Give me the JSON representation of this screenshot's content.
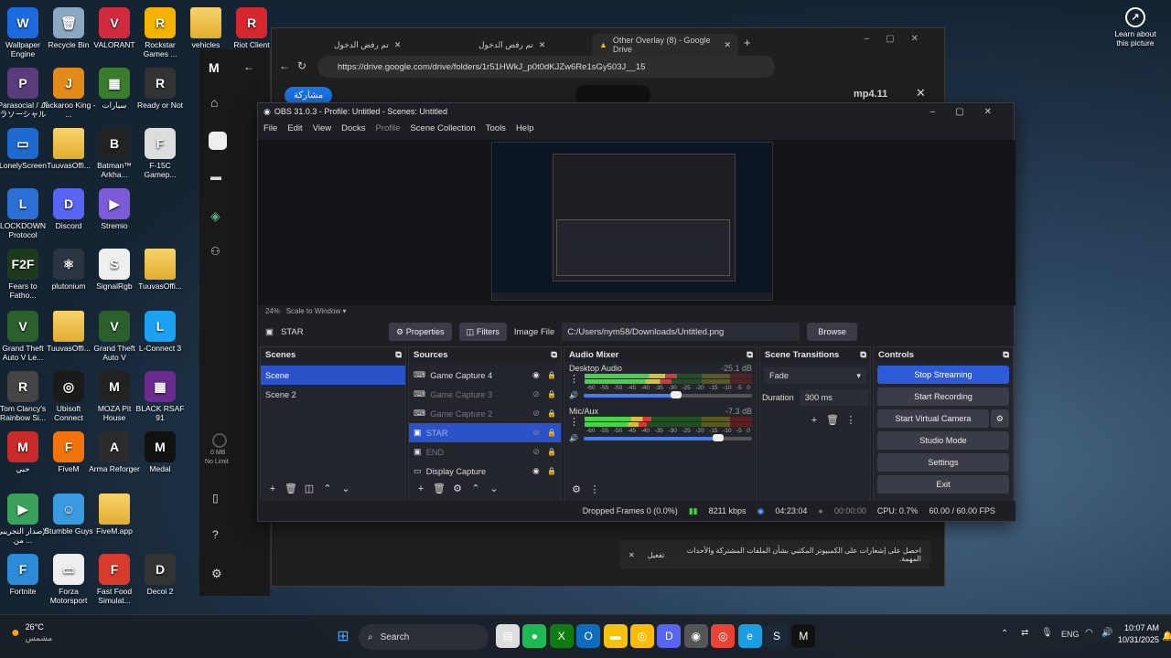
{
  "desktop_icons": [
    {
      "label": "Wallpaper Engine",
      "color": "#1c6be0",
      "glyph": "W"
    },
    {
      "label": "Recycle Bin",
      "color": "#8aa8c2",
      "glyph": "🗑"
    },
    {
      "label": "VALORANT",
      "color": "#d12a3c",
      "glyph": "V"
    },
    {
      "label": "Rockstar Games ...",
      "color": "#f5b300",
      "glyph": "R"
    },
    {
      "label": "vehicles",
      "color": "folder",
      "glyph": ""
    },
    {
      "label": "Riot Client",
      "color": "#d6262e",
      "glyph": "R"
    },
    {
      "label": "Parasocial / パラソーシャル",
      "color": "#5a3b7c",
      "glyph": "P"
    },
    {
      "label": "Jackaroo King - ...",
      "color": "#e28a1a",
      "glyph": "J"
    },
    {
      "label": "سيارات",
      "color": "#3a7c2e",
      "glyph": "▦"
    },
    {
      "label": "Ready or Not",
      "color": "#333",
      "glyph": "R"
    },
    {
      "label": "LonelyScreen",
      "color": "#1f6ad0",
      "glyph": "▭"
    },
    {
      "label": "TuuvasOffi...",
      "color": "folder",
      "glyph": ""
    },
    {
      "label": "Batman™ Arkha...",
      "color": "#222",
      "glyph": "B"
    },
    {
      "label": "F-15C Gamep...",
      "color": "#ddd",
      "glyph": "F"
    },
    {
      "label": "LOCKDOWN Protocol",
      "color": "#2c6fd4",
      "glyph": "L"
    },
    {
      "label": "Discord",
      "color": "#5865f2",
      "glyph": "D"
    },
    {
      "label": "Stremio",
      "color": "#7b5bd6",
      "glyph": "▶"
    },
    {
      "label": "Fears to Fatho...",
      "color": "#1d3a1d",
      "glyph": "F2F"
    },
    {
      "label": "plutonium",
      "color": "#2b3542",
      "glyph": "⚛"
    },
    {
      "label": "SignalRgb",
      "color": "#eee",
      "glyph": "S"
    },
    {
      "label": "TuuvasOffi...",
      "color": "folder",
      "glyph": ""
    },
    {
      "label": "Grand Theft Auto V Le...",
      "color": "#2b5f2b",
      "glyph": "V"
    },
    {
      "label": "TuuvasOffi...",
      "color": "folder",
      "glyph": ""
    },
    {
      "label": "Grand Theft Auto V",
      "color": "#2b5f2b",
      "glyph": "V"
    },
    {
      "label": "L-Connect 3",
      "color": "#1da1f2",
      "glyph": "L"
    },
    {
      "label": "Tom Clancy's Rainbow Si...",
      "color": "#444",
      "glyph": "R"
    },
    {
      "label": "Ubisoft Connect",
      "color": "#1b1b1b",
      "glyph": "◎"
    },
    {
      "label": "MOZA Pit House",
      "color": "#222",
      "glyph": "M"
    },
    {
      "label": "BLACK RSAF 91",
      "color": "#6a2b8f",
      "glyph": "▦"
    },
    {
      "label": "حبي",
      "color": "#c92a2a",
      "glyph": "M"
    },
    {
      "label": "FiveM",
      "color": "#f2720c",
      "glyph": "F"
    },
    {
      "label": "Arma Reforger",
      "color": "#2c2c2c",
      "glyph": "A"
    },
    {
      "label": "Medal",
      "color": "#111",
      "glyph": "M"
    },
    {
      "label": "الإصدار التجريبي من ...",
      "color": "#3aa15a",
      "glyph": "▶"
    },
    {
      "label": "Stumble Guys",
      "color": "#3b9be0",
      "glyph": "☺"
    },
    {
      "label": "FiveM.app",
      "color": "folder",
      "glyph": ""
    },
    {
      "label": "Fortnite",
      "color": "#2c8ad6",
      "glyph": "F"
    },
    {
      "label": "Forza Motorsport",
      "color": "#eee",
      "glyph": "▭"
    },
    {
      "label": "Fast Food Simulat...",
      "color": "#d83a2c",
      "glyph": "F"
    },
    {
      "label": "Decoi 2",
      "color": "#333",
      "glyph": "D"
    }
  ],
  "learn_about": "Learn about this picture",
  "browser": {
    "tabs": [
      "تم رفض الدخول",
      "تم رفض الدخول",
      "Other Overlay (8) - Google Drive"
    ],
    "url": "https://drive.google.com/drive/folders/1r51HWkJ_p0t0dKJZw6Re1sGy503J__15",
    "share_label": "مشاركة",
    "file_name": "mp4.11",
    "notification": "احصل على إشعارات على الكمبيوتر المكتبي بشأن الملفات المشتركة والأحداث المهمة.",
    "notification_action": "تفعيل"
  },
  "obs": {
    "title": "OBS 31.0.3 - Profile: Untitled - Scenes: Untitled",
    "menu": [
      "File",
      "Edit",
      "View",
      "Docks",
      "Profile",
      "Scene Collection",
      "Tools",
      "Help"
    ],
    "zoom": "24%",
    "scale_mode": "Scale to Window",
    "source_bar": {
      "name": "STAR",
      "properties": "Properties",
      "filters": "Filters",
      "image_file_label": "Image File",
      "path": "C:/Users/nym58/Downloads/Untitled.png",
      "browse": "Browse"
    },
    "scenes": {
      "title": "Scenes",
      "items": [
        "Scene",
        "Scene 2"
      ]
    },
    "sources": {
      "title": "Sources",
      "items": [
        {
          "name": "Game Capture 4",
          "icon": "gamepad-icon",
          "visible": true
        },
        {
          "name": "Game Capture 3",
          "icon": "gamepad-icon",
          "visible": false
        },
        {
          "name": "Game Capture 2",
          "icon": "gamepad-icon",
          "visible": false
        },
        {
          "name": "STAR",
          "icon": "image-icon",
          "visible": false
        },
        {
          "name": "END",
          "icon": "image-icon",
          "visible": false
        },
        {
          "name": "Display Capture",
          "icon": "monitor-icon",
          "visible": true
        }
      ]
    },
    "mixer": {
      "title": "Audio Mixer",
      "channels": [
        {
          "name": "Desktop Audio",
          "db": "-25.1 dB",
          "level": 0.55,
          "volume": 0.55
        },
        {
          "name": "Mic/Aux",
          "db": "-7.3 dB",
          "level": 0.4,
          "volume": 0.8
        }
      ],
      "scale": [
        "-60",
        "-55",
        "-50",
        "-45",
        "-40",
        "-35",
        "-30",
        "-25",
        "-20",
        "-15",
        "-10",
        "-5",
        "0"
      ]
    },
    "transitions": {
      "title": "Scene Transitions",
      "type": "Fade",
      "duration_label": "Duration",
      "duration": "300 ms"
    },
    "controls": {
      "title": "Controls",
      "stop_streaming": "Stop Streaming",
      "start_recording": "Start Recording",
      "start_virtual_camera": "Start Virtual Camera",
      "studio_mode": "Studio Mode",
      "settings": "Settings",
      "exit": "Exit"
    },
    "status": {
      "dropped": "Dropped Frames 0 (0.0%)",
      "kbps": "8211 kbps",
      "stream_time": "04:23:04",
      "rec_time": "00:00:00",
      "cpu": "CPU: 0.7%",
      "fps": "60.00 / 60.00 FPS"
    }
  },
  "gmail_side": {
    "mem": "0 MB",
    "limit": "No Limit"
  },
  "taskbar": {
    "weather_temp": "26°C",
    "weather_text": "مشمس",
    "search": "Search",
    "lang": "ENG",
    "time": "10:07 AM",
    "date": "10/31/2025"
  }
}
